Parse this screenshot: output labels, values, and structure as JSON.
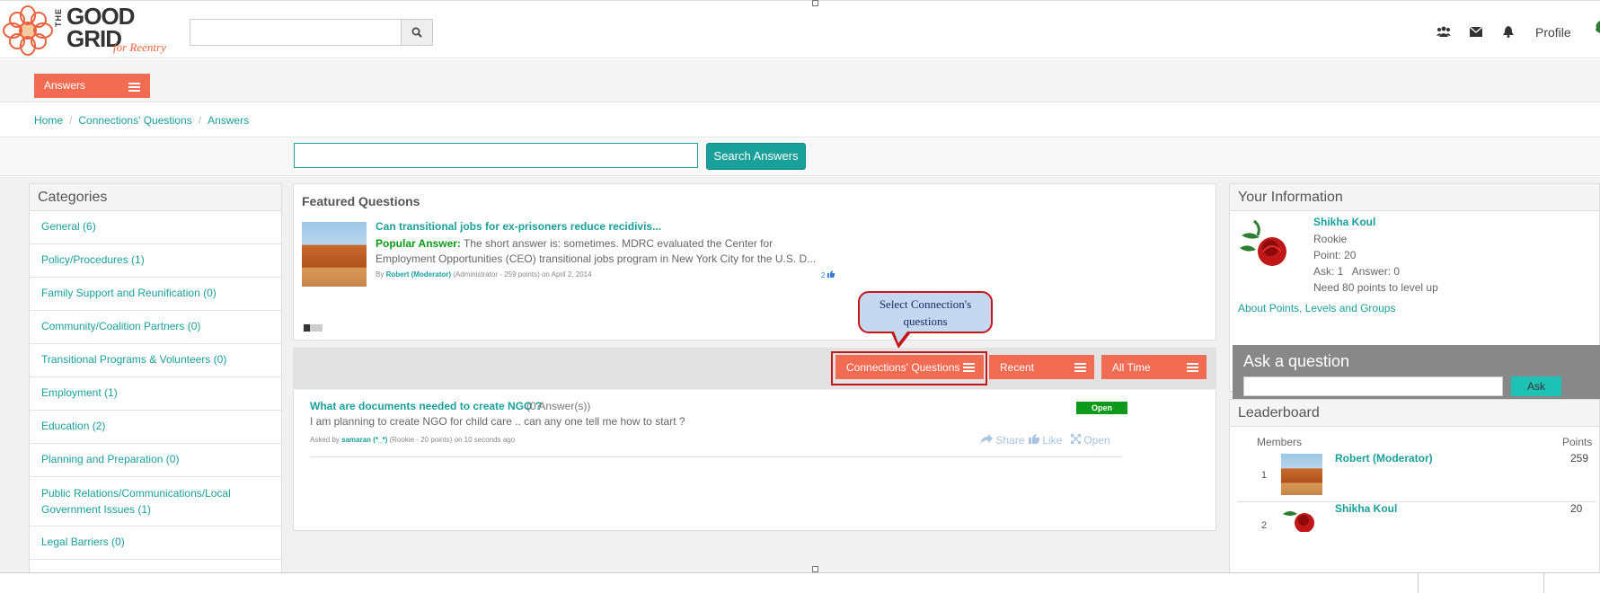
{
  "header": {
    "logo_text_line1": "THE",
    "logo_text_line2": "GOOD",
    "logo_text_line3": "GRID",
    "logo_tagline": "for Reentry",
    "search_placeholder": "",
    "profile_label": "Profile"
  },
  "tabs": {
    "answers_label": "Answers"
  },
  "breadcrumb": [
    "Home",
    "Connections' Questions",
    "Answers"
  ],
  "search_answers": {
    "input_value": "",
    "button_label": "Search Answers"
  },
  "categories": {
    "title": "Categories",
    "items": [
      "General (6)",
      "Policy/Procedures (1)",
      "Family Support and Reunification (0)",
      "Community/Coalition Partners (0)",
      "Transitional Programs & Volunteers (0)",
      "Employment (1)",
      "Education (2)",
      "Planning and Preparation (0)",
      "Public Relations/Communications/Local Government Issues (1)",
      "Legal Barriers (0)"
    ]
  },
  "featured": {
    "title": "Featured Questions",
    "question_title": "Can transitional jobs for ex-prisoners reduce recidivis...",
    "popular_answer_label": "Popular Answer:",
    "popular_answer_text": "The short answer is: sometimes. MDRC evaluated the Center for Employment Opportunities (CEO) transitional jobs program in New York City for the U.S. D...",
    "meta_by": "By",
    "meta_author": "Robert (Moderator)",
    "meta_role": "(Administrator - 259 points)",
    "meta_date": "on April 2, 2014",
    "likes": "2"
  },
  "filters": {
    "connections": "Connections' Questions",
    "recent": "Recent",
    "all_time": "All Time"
  },
  "callout": {
    "line1": "Select Connection's",
    "line2": "questions"
  },
  "question": {
    "title": "What are documents needed to create NGO ?",
    "answer_count": "(0 Answer(s))",
    "body": "I am planning to create NGO for child care .. can any one tell me how to start ?",
    "asked_by": "Asked by",
    "author": "samaran (*_*)",
    "author_meta": "(Rookie - 20 points)",
    "time": "on 10 seconds ago",
    "status": "Open",
    "share": "Share",
    "like": "Like",
    "open": "Open"
  },
  "your_info": {
    "title": "Your Information",
    "name": "Shikha Koul",
    "rank": "Rookie",
    "points": "Point: 20",
    "ask_answer": "Ask: 1   Answer: 0",
    "level_up": "Need 80 points to level up",
    "about_link": "About Points, Levels and Groups"
  },
  "ask": {
    "title": "Ask a question",
    "input_value": "",
    "button_label": "Ask"
  },
  "leaderboard": {
    "title": "Leaderboard",
    "col_members": "Members",
    "col_points": "Points",
    "rows": [
      {
        "rank": "1",
        "name": "Robert (Moderator)",
        "points": "259"
      },
      {
        "rank": "2",
        "name": "Shikha Koul",
        "points": "20"
      }
    ]
  },
  "colors": {
    "accent_orange": "#f26b53",
    "teal": "#1aa09a",
    "open_green": "#0d9a1a",
    "highlight_red": "#c4161c"
  }
}
